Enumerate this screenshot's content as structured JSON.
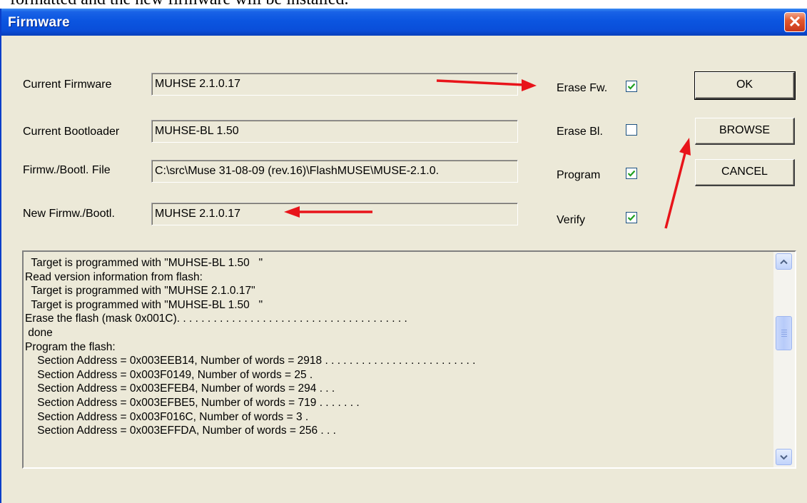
{
  "document": {
    "cut_text": "formatted and the new firmware will be installed."
  },
  "window": {
    "title": "Firmware",
    "close_glyph": "✕"
  },
  "form": {
    "current_firmware": {
      "label": "Current Firmware",
      "value": "MUHSE 2.1.0.17"
    },
    "current_bootloader": {
      "label": "Current Bootloader",
      "value": "MUHSE-BL 1.50"
    },
    "file": {
      "label": "Firmw./Bootl. File",
      "value": "C:\\src\\Muse 31-08-09 (rev.16)\\FlashMUSE\\MUSE-2.1.0."
    },
    "new_firmware": {
      "label": "New Firmw./Bootl.",
      "value": "MUHSE 2.1.0.17"
    }
  },
  "options": [
    {
      "label": "Erase Fw.",
      "checked": true
    },
    {
      "label": "Erase Bl.",
      "checked": false
    },
    {
      "label": "Program",
      "checked": true
    },
    {
      "label": "Verify",
      "checked": true
    }
  ],
  "buttons": {
    "ok": "OK",
    "browse": "BROWSE",
    "cancel": "CANCEL"
  },
  "log": {
    "lines": [
      "  Target is programmed with \"MUHSE-BL 1.50   \"",
      "Read version information from flash:",
      "  Target is programmed with \"MUHSE 2.1.0.17\"",
      "  Target is programmed with \"MUHSE-BL 1.50   \"",
      "Erase the flash (mask 0x001C). . . . . . . . . . . . . . . . . . . . . . . . . . . . . . . . . . . . . .",
      " done",
      "Program the flash:",
      "    Section Address = 0x003EEB14, Number of words = 2918 . . . . . . . . . . . . . . . . . . . . . . . . .",
      "    Section Address = 0x003F0149, Number of words = 25 .",
      "    Section Address = 0x003EFEB4, Number of words = 294 . . .",
      "    Section Address = 0x003EFBE5, Number of words = 719 . . . . . . .",
      "    Section Address = 0x003F016C, Number of words = 3 .",
      "    Section Address = 0x003EFFDA, Number of words = 256 . . ."
    ]
  },
  "colors": {
    "accent": "#0a4ed9",
    "annotation": "#e8141a",
    "face": "#ece9d8"
  }
}
